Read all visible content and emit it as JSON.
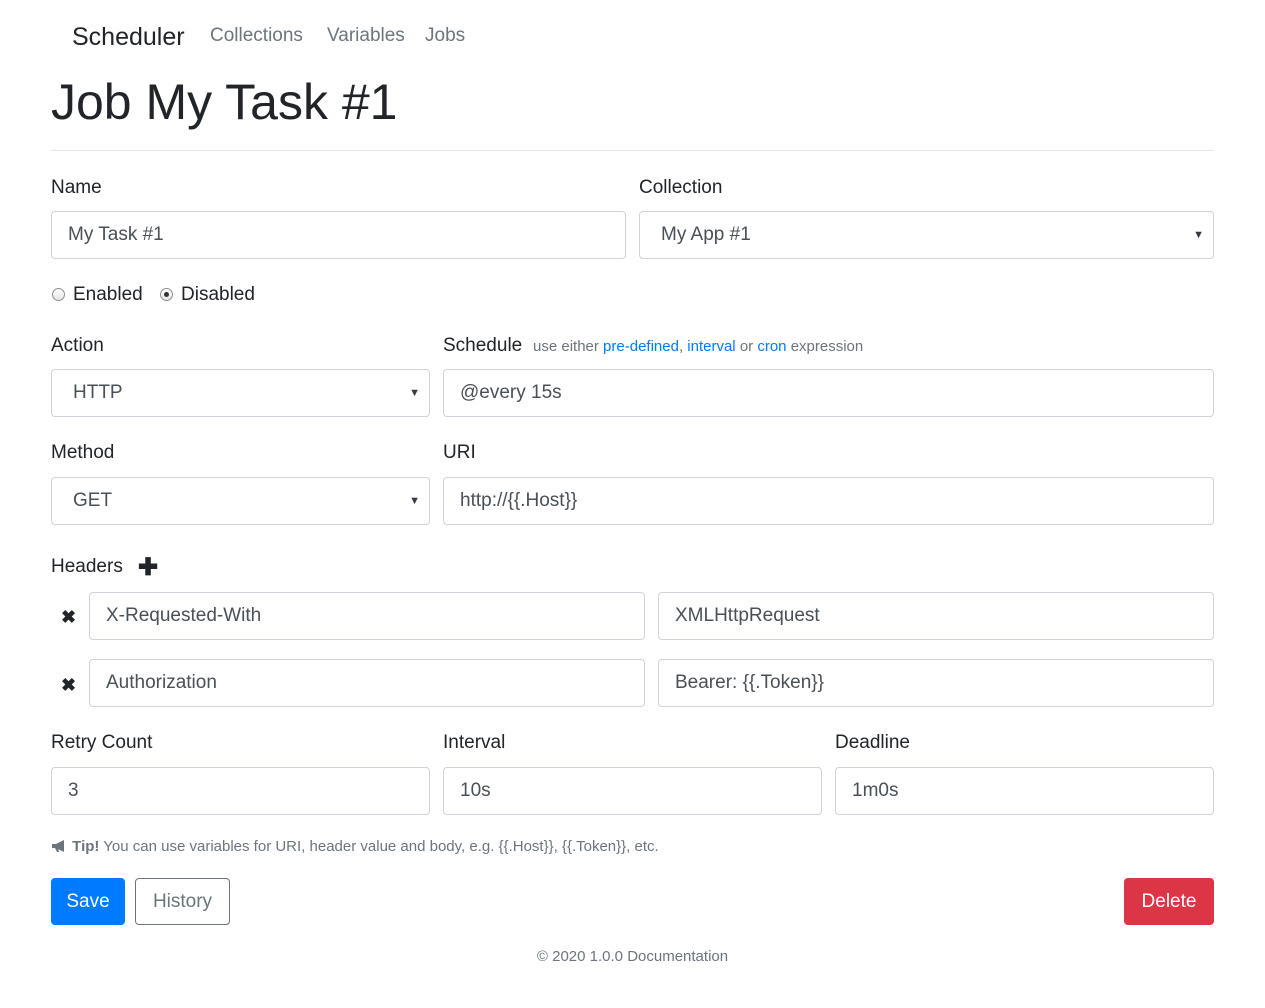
{
  "nav": {
    "brand": "Scheduler",
    "links": [
      "Collections",
      "Variables",
      "Jobs"
    ]
  },
  "page": {
    "title": "Job My Task #1"
  },
  "form": {
    "name": {
      "label": "Name",
      "value": "My Task #1"
    },
    "collection": {
      "label": "Collection",
      "value": "My App #1"
    },
    "status": {
      "options": [
        "Enabled",
        "Disabled"
      ],
      "selected": "Disabled"
    },
    "action": {
      "label": "Action",
      "value": "HTTP"
    },
    "schedule": {
      "label": "Schedule",
      "hint_prefix": "use either",
      "hint_link1": "pre-defined",
      "hint_sep": ",",
      "hint_link2": "interval",
      "hint_or": "or",
      "hint_link3": "cron",
      "hint_suffix": "expression",
      "value": "@every 15s"
    },
    "method": {
      "label": "Method",
      "value": "GET"
    },
    "uri": {
      "label": "URI",
      "value": "http://{{.Host}}"
    },
    "headers": {
      "label": "Headers",
      "add_icon": "plus-icon",
      "remove_icon": "close-icon",
      "rows": [
        {
          "key": "X-Requested-With",
          "value": "XMLHttpRequest"
        },
        {
          "key": "Authorization",
          "value": "Bearer: {{.Token}}"
        }
      ]
    },
    "retry_count": {
      "label": "Retry Count",
      "value": "3"
    },
    "interval": {
      "label": "Interval",
      "value": "10s"
    },
    "deadline": {
      "label": "Deadline",
      "value": "1m0s"
    },
    "tip": {
      "icon": "bullhorn-icon",
      "strong": "Tip!",
      "text": "You can use variables for URI, header value and body, e.g. {{.Host}}, {{.Token}}, etc."
    }
  },
  "buttons": {
    "save": "Save",
    "history": "History",
    "delete": "Delete"
  },
  "colors": {
    "primary": "#007bff",
    "danger": "#dc3545",
    "muted": "#6c757d",
    "border": "#ced4da"
  },
  "footer": {
    "text": "© 2020 1.0.0 Documentation"
  }
}
